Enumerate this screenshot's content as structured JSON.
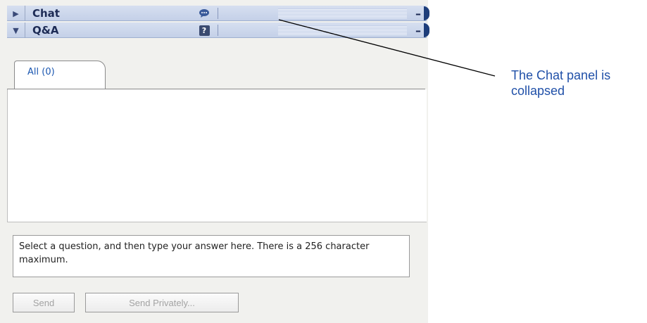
{
  "panels": {
    "chat": {
      "title": "Chat",
      "state": "collapsed",
      "toggle_glyph": "▶",
      "icon": "speech-bubble-icon",
      "minimize_glyph": "–"
    },
    "qa": {
      "title": "Q&A",
      "state": "expanded",
      "toggle_glyph": "▼",
      "icon": "question-mark-icon",
      "icon_glyph": "?",
      "minimize_glyph": "–"
    }
  },
  "qa": {
    "tabs": [
      {
        "label": "All (0)",
        "selected": true
      }
    ],
    "answer_placeholder": "Select a question, and then type your answer here. There is a 256 character maximum.",
    "send_label": "Send",
    "send_privately_label": "Send Privately..."
  },
  "callout": {
    "text": "The Chat panel is collapsed",
    "color": "#2050a8"
  },
  "colors": {
    "header_bg": "#c4d0e8",
    "header_text": "#1d2b55",
    "tab_text": "#1a56b0",
    "disabled_text": "#a3a3a3"
  }
}
